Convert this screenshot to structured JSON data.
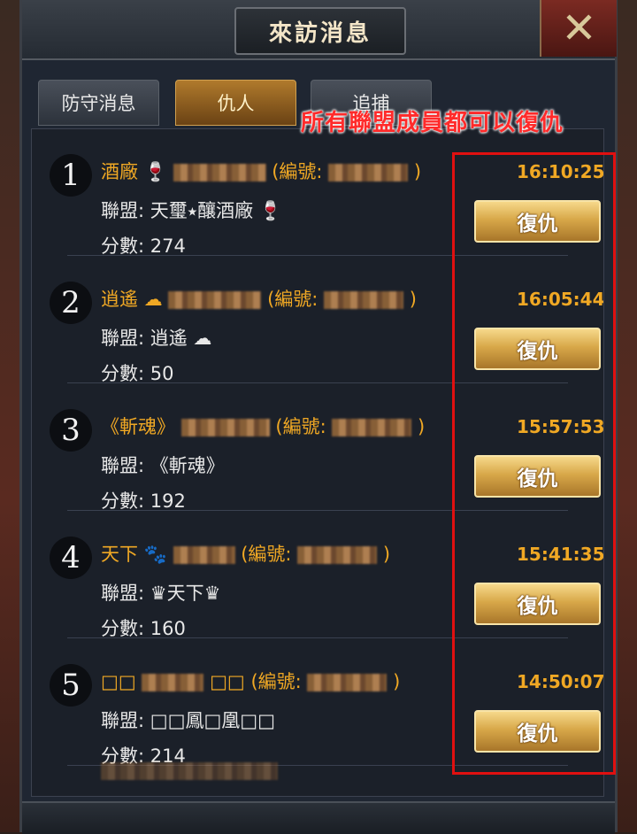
{
  "window": {
    "title": "來訪消息",
    "close_icon": "close-x-icon"
  },
  "tabs": [
    {
      "label": "防守消息",
      "active": false
    },
    {
      "label": "仇人",
      "active": true
    },
    {
      "label": "追捕",
      "active": false
    }
  ],
  "annotation": "所有聯盟成員都可以復仇",
  "labels": {
    "union": "聯盟:",
    "score": "分數:",
    "revenge": "復仇",
    "id_open": "(編號:",
    "id_close": ")"
  },
  "enemies": [
    {
      "rank": "1",
      "name": "酒廠",
      "union": "天璽⭑釀酒廠",
      "score": "274",
      "time": "16:10:25"
    },
    {
      "rank": "2",
      "name": "逍遙",
      "union": "逍遙",
      "score": "50",
      "time": "16:05:44"
    },
    {
      "rank": "3",
      "name": "《斬魂》",
      "union": "《斬魂》",
      "score": "192",
      "time": "15:57:53"
    },
    {
      "rank": "4",
      "name": "天下",
      "union": "♛天下♛",
      "score": "160",
      "time": "15:41:35"
    },
    {
      "rank": "5",
      "name": "□□",
      "name_suffix": "□□",
      "union": "□□鳳□凰□□",
      "score": "214",
      "time": "14:50:07"
    }
  ],
  "colors": {
    "accent": "#f0a824",
    "highlight_box": "#e01010"
  }
}
